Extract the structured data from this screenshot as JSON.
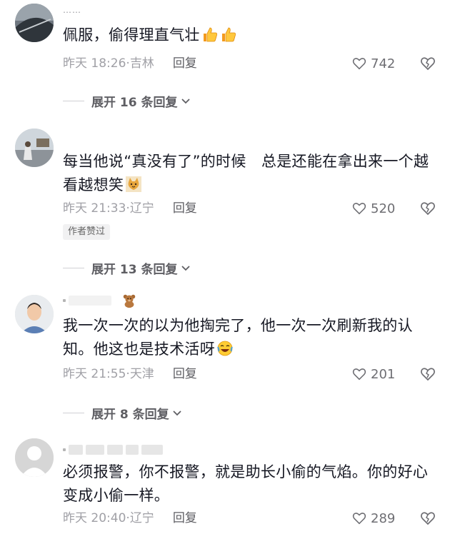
{
  "comments": [
    {
      "username": "……",
      "text": "佩服，偷得理直气壮",
      "emoji": [
        "thumbs-up-icon",
        "thumbs-up-icon"
      ],
      "time": "昨天 18:26",
      "location": "吉林",
      "reply_label": "回复",
      "likes": "742",
      "expand_label": "展开 16 条回复"
    },
    {
      "username": "",
      "text": "每当他说“真没有了”的时候　总是还能在拿出来一个越看越想笑",
      "emoji": [
        "cat-icon"
      ],
      "time": "昨天 21:33",
      "location": "辽宁",
      "reply_label": "回复",
      "likes": "520",
      "badge": "作者赞过",
      "expand_label": "展开 13 条回复"
    },
    {
      "username": "",
      "text": "我一次一次的以为他掏完了，他一次一次刷新我的认知。他这也是技术活呀",
      "emoji": [
        "teddy-bear-icon",
        "laughing-crying-icon"
      ],
      "time": "昨天 21:55",
      "location": "天津",
      "reply_label": "回复",
      "likes": "201",
      "expand_label": "展开 8 条回复"
    },
    {
      "username": "",
      "text": "必须报警，你不报警，就是助长小偷的气焰。你的好心变成小偷一样。",
      "time": "昨天 20:40",
      "location": "辽宁",
      "reply_label": "回复",
      "likes": "289"
    }
  ],
  "colors": {
    "text": "#161823",
    "meta": "#a0a0a6",
    "reply": "#5e5e63",
    "badge_bg": "#f1f1f2"
  }
}
